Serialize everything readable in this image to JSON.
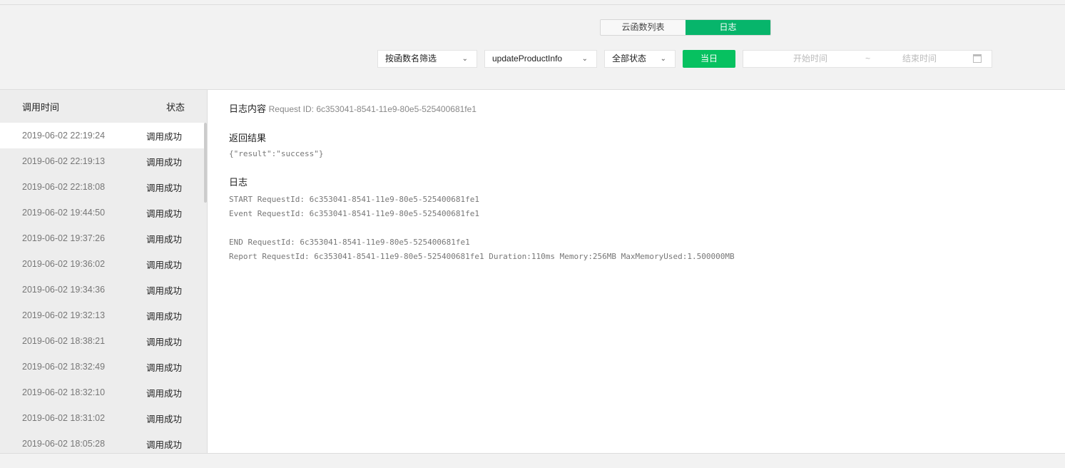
{
  "tabs": [
    {
      "label": "云函数列表",
      "active": false
    },
    {
      "label": "日志",
      "active": true
    }
  ],
  "filters": {
    "function_filter": "按函数名筛选",
    "function_name": "updateProductInfo",
    "status": "全部状态",
    "today": "当日",
    "start_placeholder": "开始时间",
    "sep": "~",
    "end_placeholder": "结束时间"
  },
  "list": {
    "col_time": "调用时间",
    "col_status": "状态",
    "rows": [
      {
        "time": "2019-06-02 22:19:24",
        "status": "调用成功"
      },
      {
        "time": "2019-06-02 22:19:13",
        "status": "调用成功"
      },
      {
        "time": "2019-06-02 22:18:08",
        "status": "调用成功"
      },
      {
        "time": "2019-06-02 19:44:50",
        "status": "调用成功"
      },
      {
        "time": "2019-06-02 19:37:26",
        "status": "调用成功"
      },
      {
        "time": "2019-06-02 19:36:02",
        "status": "调用成功"
      },
      {
        "time": "2019-06-02 19:34:36",
        "status": "调用成功"
      },
      {
        "time": "2019-06-02 19:32:13",
        "status": "调用成功"
      },
      {
        "time": "2019-06-02 18:38:21",
        "status": "调用成功"
      },
      {
        "time": "2019-06-02 18:32:49",
        "status": "调用成功"
      },
      {
        "time": "2019-06-02 18:32:10",
        "status": "调用成功"
      },
      {
        "time": "2019-06-02 18:31:02",
        "status": "调用成功"
      },
      {
        "time": "2019-06-02 18:05:28",
        "status": "调用成功"
      }
    ]
  },
  "detail": {
    "title": "日志内容",
    "request_id": "Request ID: 6c353041-8541-11e9-80e5-525400681fe1",
    "result_label": "返回结果",
    "result": "{\"result\":\"success\"}",
    "log_label": "日志",
    "log_lines": [
      "START RequestId: 6c353041-8541-11e9-80e5-525400681fe1",
      "Event RequestId: 6c353041-8541-11e9-80e5-525400681fe1",
      "",
      "END RequestId: 6c353041-8541-11e9-80e5-525400681fe1",
      "Report RequestId: 6c353041-8541-11e9-80e5-525400681fe1 Duration:110ms Memory:256MB MaxMemoryUsed:1.500000MB"
    ]
  }
}
